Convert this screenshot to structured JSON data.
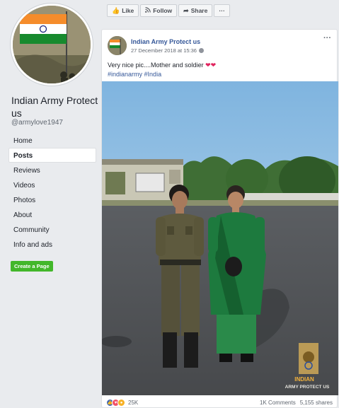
{
  "sidebar": {
    "page_name": "Indian Army Protect us",
    "handle": "@armylove1947",
    "nav": [
      {
        "label": "Home"
      },
      {
        "label": "Posts"
      },
      {
        "label": "Reviews"
      },
      {
        "label": "Videos"
      },
      {
        "label": "Photos"
      },
      {
        "label": "About"
      },
      {
        "label": "Community"
      },
      {
        "label": "Info and ads"
      }
    ],
    "active_nav": "Posts",
    "create_page_label": "Create a Page"
  },
  "actions": {
    "like_label": "Like",
    "follow_label": "Follow",
    "share_label": "Share",
    "more_label": "···"
  },
  "post": {
    "author": "Indian Army Protect us",
    "date": "27 December 2018 at 15:36",
    "more_label": "···",
    "text": "Very nice pic....Mother and soldier",
    "hearts": "❤❤",
    "hashtags": [
      "#indianarmy",
      "#India"
    ],
    "watermark_line1": "INDIAN",
    "watermark_line2": "ARMY PROTECT US",
    "reaction_count": "25K",
    "comments": "1K Comments",
    "shares": "5,155 shares"
  },
  "colors": {
    "link_blue": "#365899",
    "create_green": "#42b72a",
    "page_bg": "#e9ebee"
  }
}
